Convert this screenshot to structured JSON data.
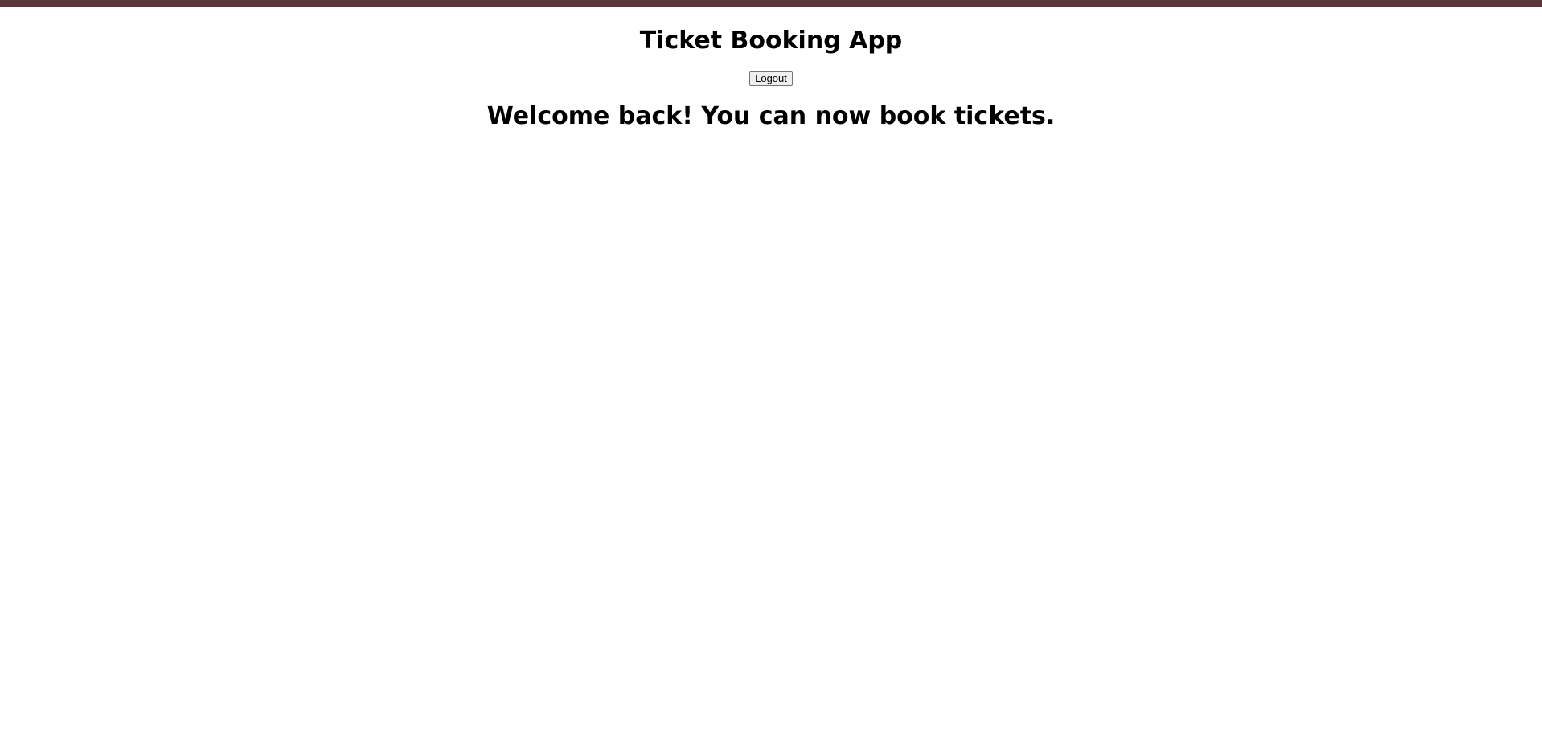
{
  "colors": {
    "top_bar": "#5a363d",
    "background": "#ffffff",
    "text": "#000000"
  },
  "header": {
    "title": "Ticket Booking App",
    "logout_label": "Logout"
  },
  "main": {
    "welcome_message": "Welcome back! You can now book tickets."
  }
}
